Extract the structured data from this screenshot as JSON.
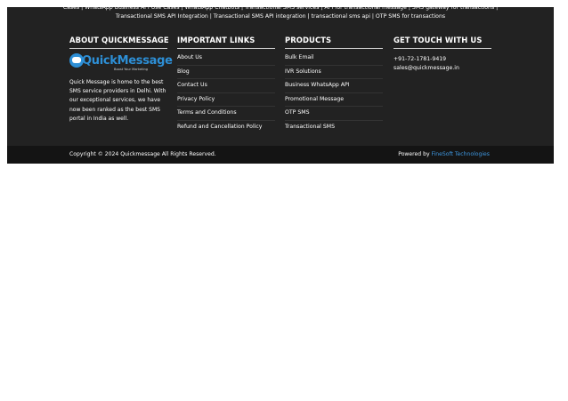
{
  "topbar": {
    "line1": "Cases | WhatsApp Business API Use Cases | WhatsApp Chatbots | Transactional SMS services | API for transactional message | SMS gateway for transactions |",
    "line2": "Transactional SMS API Integration | Transactional SMS API integration | transactional sms api | OTP SMS for transactions"
  },
  "about": {
    "heading": "ABOUT QUICKMESSAGE",
    "logo_text": "QuickMessage",
    "logo_tagline": "Boost Your Marketing",
    "text": "Quick Message is home to the best SMS service providers in Delhi. With our exceptional services, we have now been ranked as the best SMS portal in India as well."
  },
  "important_links": {
    "heading": "IMPORTANT LINKS",
    "items": [
      "About Us",
      "Blog",
      "Contact Us",
      "Privacy Policy",
      "Terms and Conditions",
      "Refund and Cancellation Policy"
    ]
  },
  "products": {
    "heading": "PRODUCTS",
    "items": [
      "Bulk Email",
      "IVR Solutions",
      "Business WhatsApp API",
      "Promotional Message",
      "OTP SMS",
      "Transactional SMS"
    ]
  },
  "get_in_touch": {
    "heading": "GET TOUCH WITH US",
    "phone": "+91-72-1781-9419",
    "email": "sales@quickmessage.in"
  },
  "bottom": {
    "copyright": "Copyright © 2024 Quickmessage All Rights Reserved.",
    "powered_prefix": "Powered by ",
    "powered_link": "FineSoft Technologies"
  },
  "colors": {
    "footer_bg": "#222222",
    "bottom_bg": "#141414",
    "accent": "#2d8fd6",
    "link": "#3e97e0"
  }
}
